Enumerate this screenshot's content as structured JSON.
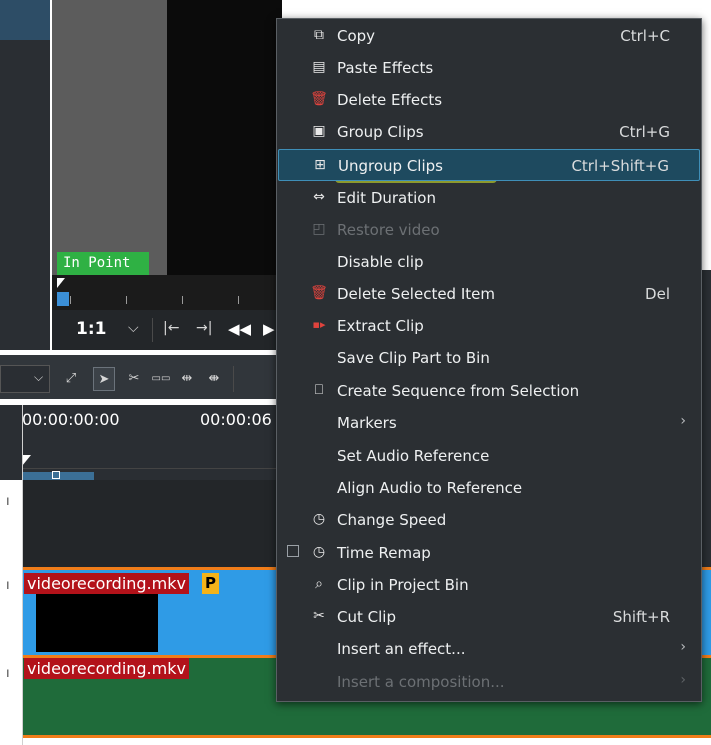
{
  "monitor": {
    "in_point_label": "In Point",
    "zoom_label": "1:1"
  },
  "timeline": {
    "timecode_start": "00:00:00:00",
    "timecode_mid": "00:00:06"
  },
  "clips": {
    "video_name": "videorecording.mkv",
    "video_badge": "P",
    "audio_name": "videorecording.mkv"
  },
  "context_menu": {
    "items": [
      {
        "label": "Copy",
        "shortcut": "Ctrl+C",
        "icon": "copy-icon"
      },
      {
        "label": "Paste Effects",
        "shortcut": "",
        "icon": "paste-icon"
      },
      {
        "label": "Delete Effects",
        "shortcut": "",
        "icon": "trash-icon"
      },
      {
        "label": "Group Clips",
        "shortcut": "Ctrl+G",
        "icon": "group-icon"
      },
      {
        "label": "Ungroup Clips",
        "shortcut": "Ctrl+Shift+G",
        "icon": "ungroup-icon"
      },
      {
        "label": "Edit Duration",
        "shortcut": "",
        "icon": "duration-icon"
      },
      {
        "label": "Restore video",
        "shortcut": "",
        "icon": "restore-icon"
      },
      {
        "label": "Disable clip",
        "shortcut": "",
        "icon": ""
      },
      {
        "label": "Delete Selected Item",
        "shortcut": "Del",
        "icon": "trash-icon"
      },
      {
        "label": "Extract Clip",
        "shortcut": "",
        "icon": "extract-icon"
      },
      {
        "label": "Save Clip Part to Bin",
        "shortcut": "",
        "icon": ""
      },
      {
        "label": "Create Sequence from Selection",
        "shortcut": "",
        "icon": "sequence-icon"
      },
      {
        "label": "Markers",
        "shortcut": "",
        "icon": ""
      },
      {
        "label": "Set Audio Reference",
        "shortcut": "",
        "icon": ""
      },
      {
        "label": "Align Audio to Reference",
        "shortcut": "",
        "icon": ""
      },
      {
        "label": "Change Speed",
        "shortcut": "",
        "icon": "speed-icon"
      },
      {
        "label": "Time Remap",
        "shortcut": "",
        "icon": "speed-icon"
      },
      {
        "label": "Clip in Project Bin",
        "shortcut": "",
        "icon": "project-bin-icon"
      },
      {
        "label": "Cut Clip",
        "shortcut": "Shift+R",
        "icon": "scissors-icon"
      },
      {
        "label": "Insert an effect...",
        "shortcut": "",
        "icon": ""
      },
      {
        "label": "Insert a composition...",
        "shortcut": "",
        "icon": ""
      }
    ]
  },
  "colors": {
    "highlight_marker": "#dcf028",
    "clip_video": "#2f9be6",
    "clip_audio": "#1f6b3a",
    "clip_label": "#b3121a",
    "in_point": "#2fb144"
  }
}
